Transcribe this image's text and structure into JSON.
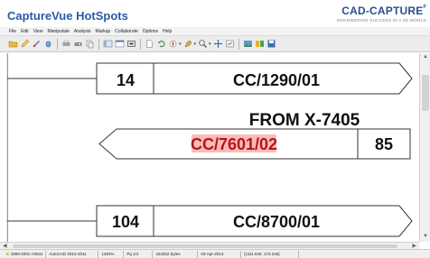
{
  "app": {
    "title": "CaptureVue HotSpots",
    "logo_main": "CAD-CAPTURE",
    "logo_tm": "P",
    "logo_sub": "ENGINEERING SUCCESS IN A 3D WORLD"
  },
  "menu": [
    "File",
    "Edit",
    "View",
    "Manipulate",
    "Analysis",
    "Markup",
    "Collaborate",
    "Options",
    "Help"
  ],
  "toolbar_icons": [
    "open-folder-icon",
    "pencil-icon",
    "markup-icon",
    "hand-icon",
    "print-icon",
    "print-preview-icon",
    "copy-icon",
    "layout-icon",
    "window-icon",
    "frame-icon",
    "page-icon",
    "rotate-icon",
    "compass-icon",
    "pen-tool-icon",
    "zoom-icon",
    "zoom-fit-icon",
    "export-icon",
    "image-icon",
    "save-icon"
  ],
  "drawing": {
    "connectors": [
      {
        "number": "14",
        "label": "CC/1290/01",
        "direction": "right"
      },
      {
        "number": "85",
        "label": "CC/7601/02",
        "direction": "left",
        "highlighted": true
      },
      {
        "number": "104",
        "label": "CC/8700/01",
        "direction": "right"
      }
    ],
    "from_label": "FROM X-7405",
    "highlight_color": "#f6a6a6",
    "highlight_text_color": "#b81414"
  },
  "status": {
    "doc_id": "1808-2001-A0511",
    "software": "AutoCAD 2010-2011",
    "zoom": "1494%",
    "page": "Pg 1/1",
    "size": "422252 bytes",
    "date": "03-Apr-2013",
    "coords": "[1111.040, 172.245]"
  }
}
